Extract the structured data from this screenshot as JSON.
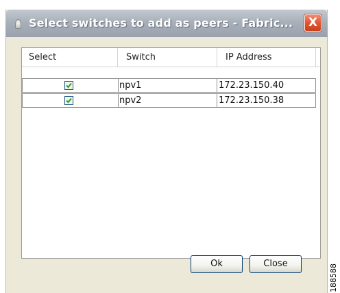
{
  "window": {
    "title": "Select switches to add as peers - Fabric...",
    "close_glyph": "X"
  },
  "table": {
    "columns": [
      "Select",
      "Switch",
      "IP Address"
    ],
    "rows": [
      {
        "selected": true,
        "switch": "npv1",
        "ip": "172.23.150.40"
      },
      {
        "selected": true,
        "switch": "npv2",
        "ip": "172.23.150.38"
      }
    ]
  },
  "buttons": {
    "ok_label": "Ok",
    "close_label": "Close"
  },
  "figure_id": "188588",
  "colors": {
    "titlebar": "#a8b0ba",
    "close_button": "#e0552f",
    "dialog_background": "#ece9d8",
    "checkbox_check": "#21a121"
  },
  "icons": [
    "app-icon",
    "close-icon",
    "checkmark-icon"
  ]
}
